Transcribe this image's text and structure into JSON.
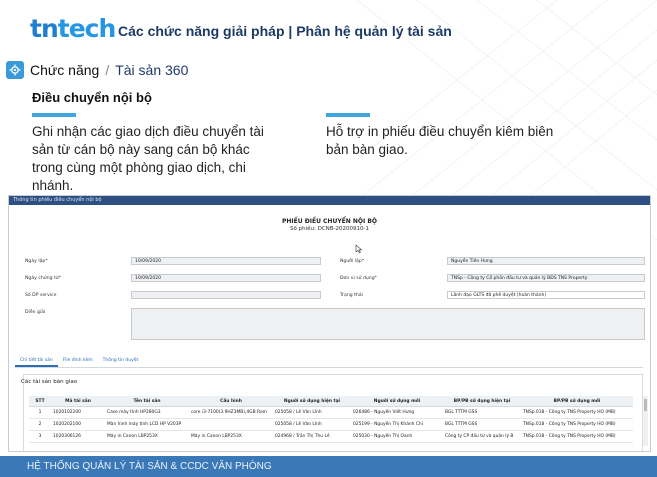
{
  "header": {
    "logo_text_1": "tn",
    "logo_text_2": "tech",
    "title": "Các chức năng giải pháp | Phân hệ quản lý tài sản"
  },
  "breadcrumb": {
    "icon": "gear-icon",
    "root": "Chức năng",
    "separator": "/",
    "leaf": "Tài sản 360"
  },
  "section": {
    "title": "Điều chuyển nội bộ",
    "feature_1": "Ghi nhận các giao dịch điều chuyển tài sản từ cán bộ này sang cán bộ khác trong cùng một phòng giao dịch, chi nhánh.",
    "feature_2": "Hỗ trợ in phiếu điều chuyển kiêm biên bản bàn giao.",
    "accent_color": "#41a6e0"
  },
  "screenshot": {
    "window_title": "Thông tin phiếu điều chuyển nội bộ",
    "form_title": "PHIẾU ĐIỀU CHUYỂN NỘI BỘ",
    "form_number": "Số phiếu: DCNB-20200910-1",
    "fields": {
      "ngay_lap_label": "Ngày lập*",
      "ngay_lap_value": "10/09/2020",
      "ngay_chung_tu_label": "Ngày chứng từ*",
      "ngay_chung_tu_value": "10/09/2020",
      "so_dp_label": "Số DP service",
      "so_dp_value": "",
      "dien_giai_label": "Diễn giải",
      "nguoi_lap_label": "Người lập*",
      "nguoi_lap_value": "Nguyễn Tiến Hưng",
      "don_vi_label": "Đơn vị sử dụng*",
      "don_vi_value": "TNSp - Công ty Cổ phần đầu tư và quản lý BĐS TNS Property",
      "trang_thai_label": "Trạng thái",
      "trang_thai_value": "Lãnh đạo GLTS đã phê duyệt (hoàn thành)"
    },
    "tabs": [
      "Chi tiết tài sản",
      "File đính kèm",
      "Thông tin duyệt"
    ],
    "assets_title": "Các tài sản bàn giao",
    "table": {
      "headers": [
        "STT",
        "Mã tài sản",
        "Tên tài sản",
        "Cấu hình",
        "Người sử dụng hiện tại",
        "Người sử dụng mới",
        "BP/PB sử dụng hiện tại",
        "BP/PB sử dụng mới"
      ],
      "rows": [
        [
          "1",
          "1020102200",
          "Case máy tính HP280G3",
          "core i3-7100(3.9HZ3MB),4GB Ram",
          "025058 / Lê Văn Lĩnh",
          "026486 - Nguyễn Viết Hưng",
          "BGL TTTM GSS",
          "TNSp.018 - Công ty TNS Property HO (MB)"
        ],
        [
          "2",
          "1020202100",
          "Màn hình máy tính LCD HP V203P",
          "",
          "025058 / Lê Văn Lĩnh",
          "025199 - Nguyễn Thị Khánh Chi",
          "BGL TTTM GSS",
          "TNSp.018 - Công ty TNS Property HO (MB)"
        ],
        [
          "3",
          "1020306126",
          "Máy in Canon LBP253X",
          "Máy in Canon LBP253X",
          "024968 / Trần Thị Thu Lê",
          "025030 - Nguyễn Thị Oanh",
          "Công ty CP đầu tư và quản lý B",
          "TNSp.018 - Công ty TNS Property HO (MB)"
        ]
      ]
    }
  },
  "footer": {
    "text": "HỆ THỐNG QUẢN LÝ TÀI SẢN & CCDC VĂN PHÒNG"
  },
  "colors": {
    "brand": "#1f7fd1",
    "footer_bg": "#3b78b8",
    "title": "#1d3a66"
  }
}
